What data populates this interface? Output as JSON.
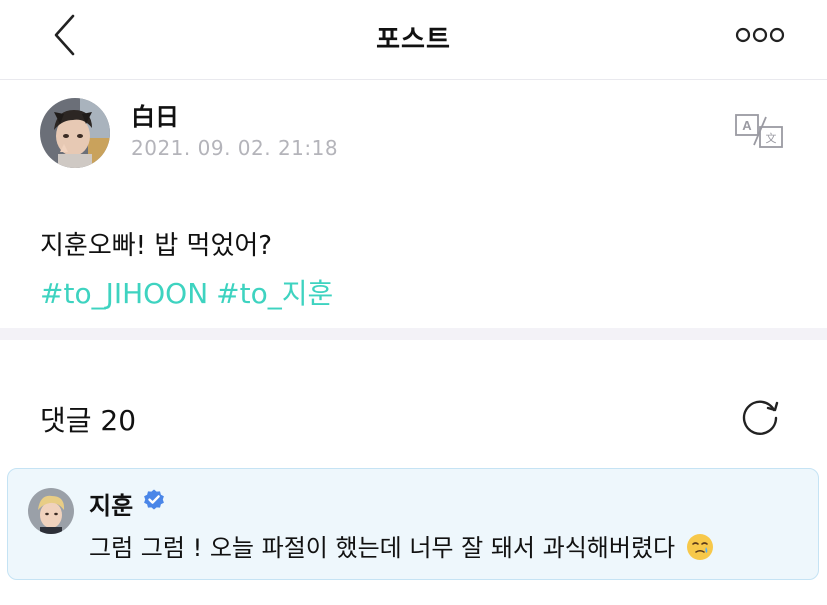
{
  "header": {
    "title": "포스트",
    "back_icon": "chevron-left-icon",
    "more_icon": "more-horizontal-icon"
  },
  "post": {
    "author": "白日",
    "timestamp": "2021. 09. 02. 21:18",
    "text": "지훈오빠! 밥 먹었어?",
    "hashtags": [
      "#to_JIHOON",
      "#to_지훈"
    ],
    "translate_icon": "translate-icon"
  },
  "comments": {
    "label": "댓글 20",
    "refresh_icon": "refresh-icon",
    "items": [
      {
        "author": "지훈",
        "verified": true,
        "text": "그럼 그럼 ! 오늘 파절이 했는데 너무 잘 돼서 과식해버렸다",
        "emoji_icon": "smiling-tear-emoji-icon"
      }
    ]
  },
  "colors": {
    "hashtag": "#3ed3c0",
    "timestamp": "#b4b4ba",
    "comment_bg": "#eef7fc",
    "comment_border": "#c5e3f4",
    "verified": "#4a86e8",
    "divider": "#f3f2f7"
  }
}
